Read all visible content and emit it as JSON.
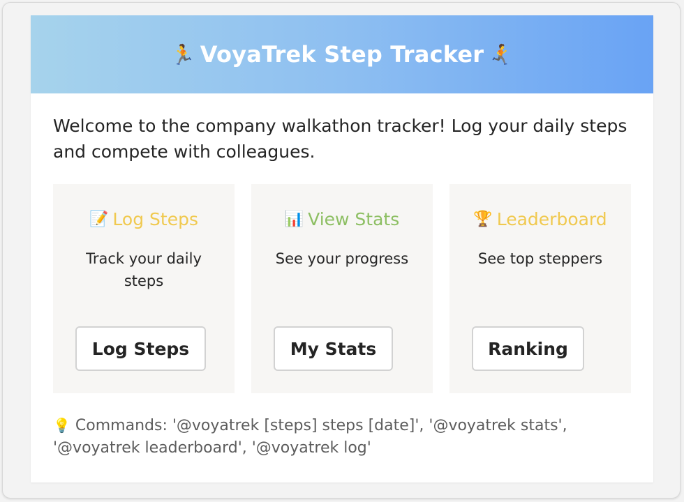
{
  "header": {
    "title": "VoyaTrek Step Tracker",
    "icon_left": "🏃",
    "icon_right": "🏃",
    "gradient": [
      "#a6d3ec",
      "#69a3f4"
    ]
  },
  "intro": {
    "text": "Welcome to the company walkathon tracker! Log your daily steps and compete with colleagues."
  },
  "tiles": [
    {
      "icon": "📝",
      "icon_name": "memo-icon",
      "title": "Log Steps",
      "title_color": "#f0c94f",
      "description": "Track your daily steps",
      "button_label": "Log Steps"
    },
    {
      "icon": "📊",
      "icon_name": "bar-chart-icon",
      "title": "View Stats",
      "title_color": "#8dbf63",
      "description": "See your progress",
      "button_label": "My Stats"
    },
    {
      "icon": "🏆",
      "icon_name": "trophy-icon",
      "title": "Leaderboard",
      "title_color": "#f0c94f",
      "description": "See top steppers",
      "button_label": "Ranking"
    }
  ],
  "footer": {
    "icon": "💡",
    "text": "Commands: '@voyatrek [steps] steps [date]', '@voyatrek stats', '@voyatrek leaderboard', '@voyatrek log'"
  }
}
